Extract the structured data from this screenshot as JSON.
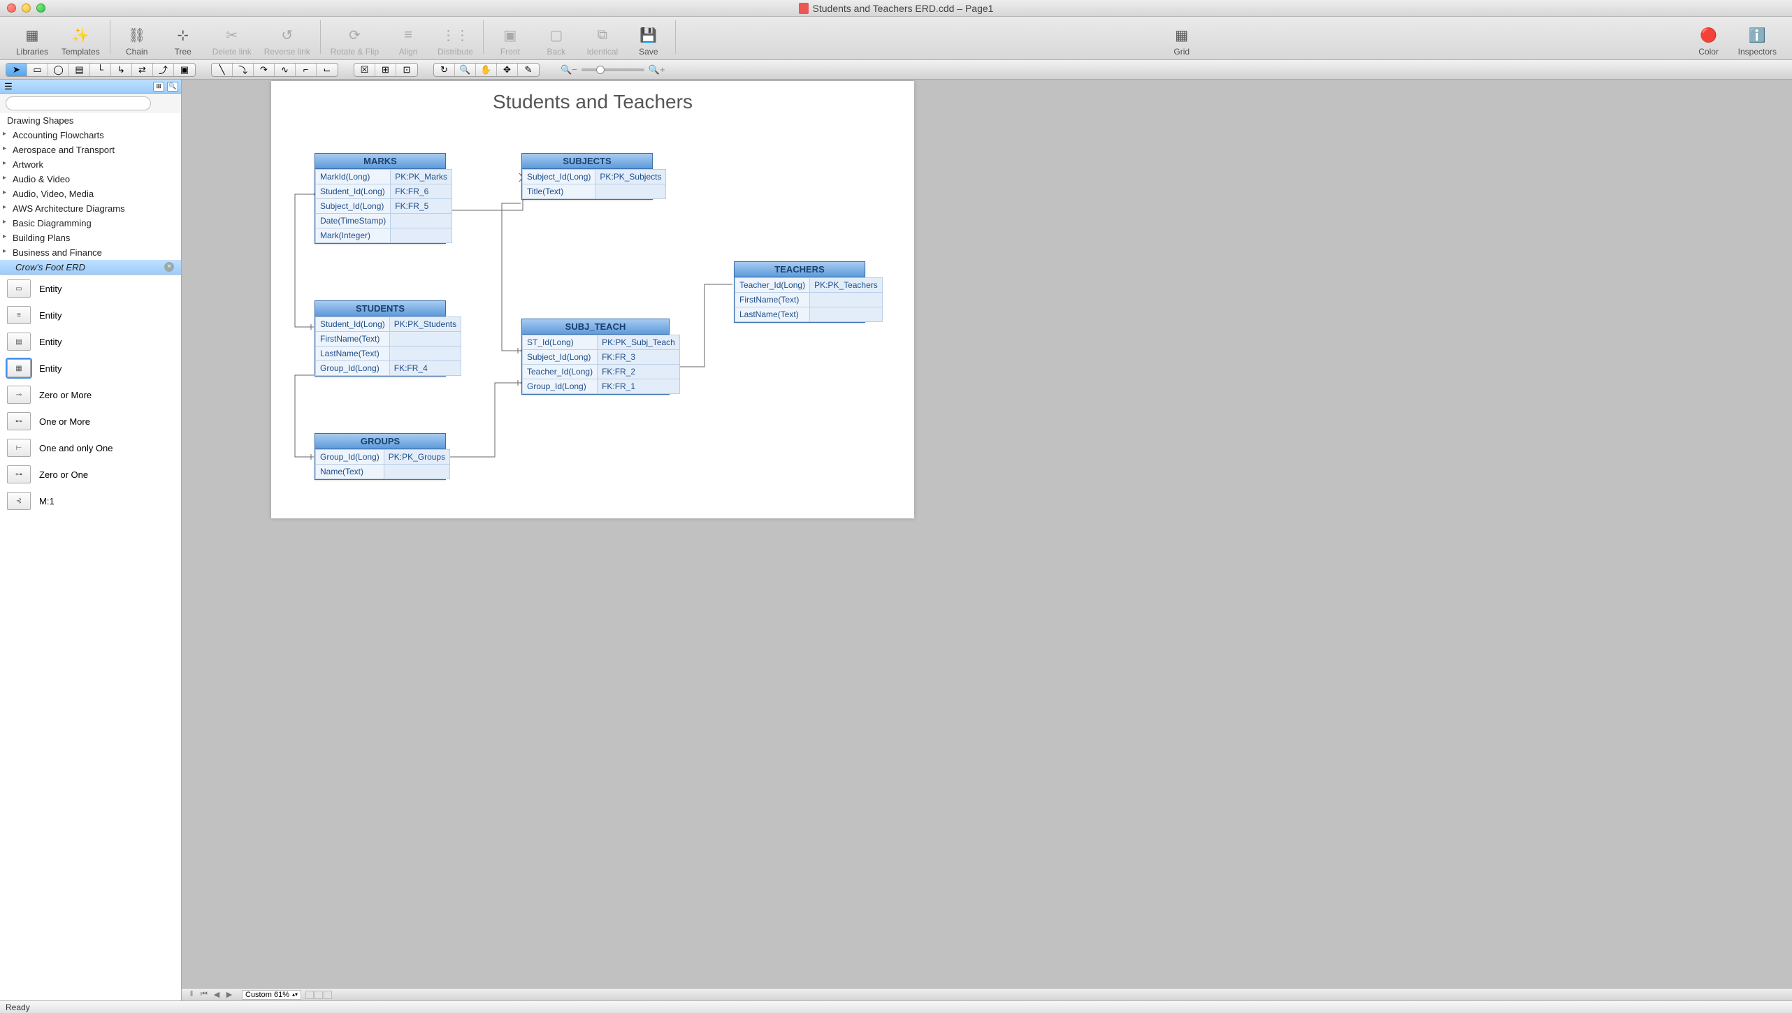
{
  "window": {
    "title": "Students and Teachers ERD.cdd – Page1"
  },
  "main_toolbar": {
    "libraries": "Libraries",
    "templates": "Templates",
    "chain": "Chain",
    "tree": "Tree",
    "delete_link": "Delete link",
    "reverse_link": "Reverse link",
    "rotate_flip": "Rotate & Flip",
    "align": "Align",
    "distribute": "Distribute",
    "front": "Front",
    "back": "Back",
    "identical": "Identical",
    "save": "Save",
    "grid": "Grid",
    "color": "Color",
    "inspectors": "Inspectors"
  },
  "sidebar": {
    "categories_header": "Drawing Shapes",
    "categories": [
      "Accounting Flowcharts",
      "Aerospace and Transport",
      "Artwork",
      "Audio & Video",
      "Audio, Video, Media",
      "AWS Architecture Diagrams",
      "Basic Diagramming",
      "Building Plans",
      "Business and Finance"
    ],
    "selected_category": "Crow's Foot ERD",
    "shapes": [
      {
        "label": "Entity",
        "glyph": "▭"
      },
      {
        "label": "Entity",
        "glyph": "≡"
      },
      {
        "label": "Entity",
        "glyph": "▤"
      },
      {
        "label": "Entity",
        "glyph": "▦",
        "active": true
      },
      {
        "label": "Zero or More",
        "glyph": "⊸"
      },
      {
        "label": "One or More",
        "glyph": "⊷"
      },
      {
        "label": "One and only One",
        "glyph": "⊢"
      },
      {
        "label": "Zero or One",
        "glyph": "⊶"
      },
      {
        "label": "M:1",
        "glyph": "⊰"
      }
    ]
  },
  "diagram": {
    "title": "Students and Teachers",
    "entities": {
      "marks": {
        "name": "MARKS",
        "rows": [
          [
            "MarkId(Long)",
            "PK:PK_Marks"
          ],
          [
            "Student_Id(Long)",
            "FK:FR_6"
          ],
          [
            "Subject_Id(Long)",
            "FK:FR_5"
          ],
          [
            "Date(TimeStamp)",
            ""
          ],
          [
            "Mark(Integer)",
            ""
          ]
        ]
      },
      "subjects": {
        "name": "SUBJECTS",
        "rows": [
          [
            "Subject_Id(Long)",
            "PK:PK_Subjects"
          ],
          [
            "Title(Text)",
            ""
          ]
        ]
      },
      "students": {
        "name": "STUDENTS",
        "rows": [
          [
            "Student_Id(Long)",
            "PK:PK_Students"
          ],
          [
            "FirstName(Text)",
            ""
          ],
          [
            "LastName(Text)",
            ""
          ],
          [
            "Group_Id(Long)",
            "FK:FR_4"
          ]
        ]
      },
      "subj_teach": {
        "name": "SUBJ_TEACH",
        "rows": [
          [
            "ST_Id(Long)",
            "PK:PK_Subj_Teach"
          ],
          [
            "Subject_Id(Long)",
            "FK:FR_3"
          ],
          [
            "Teacher_Id(Long)",
            "FK:FR_2"
          ],
          [
            "Group_Id(Long)",
            "FK:FR_1"
          ]
        ]
      },
      "teachers": {
        "name": "TEACHERS",
        "rows": [
          [
            "Teacher_Id(Long)",
            "PK:PK_Teachers"
          ],
          [
            "FirstName(Text)",
            ""
          ],
          [
            "LastName(Text)",
            ""
          ]
        ]
      },
      "groups": {
        "name": "GROUPS",
        "rows": [
          [
            "Group_Id(Long)",
            "PK:PK_Groups"
          ],
          [
            "Name(Text)",
            ""
          ]
        ]
      }
    }
  },
  "bottom": {
    "zoom_label": "Custom 61%"
  },
  "status": {
    "text": "Ready"
  }
}
